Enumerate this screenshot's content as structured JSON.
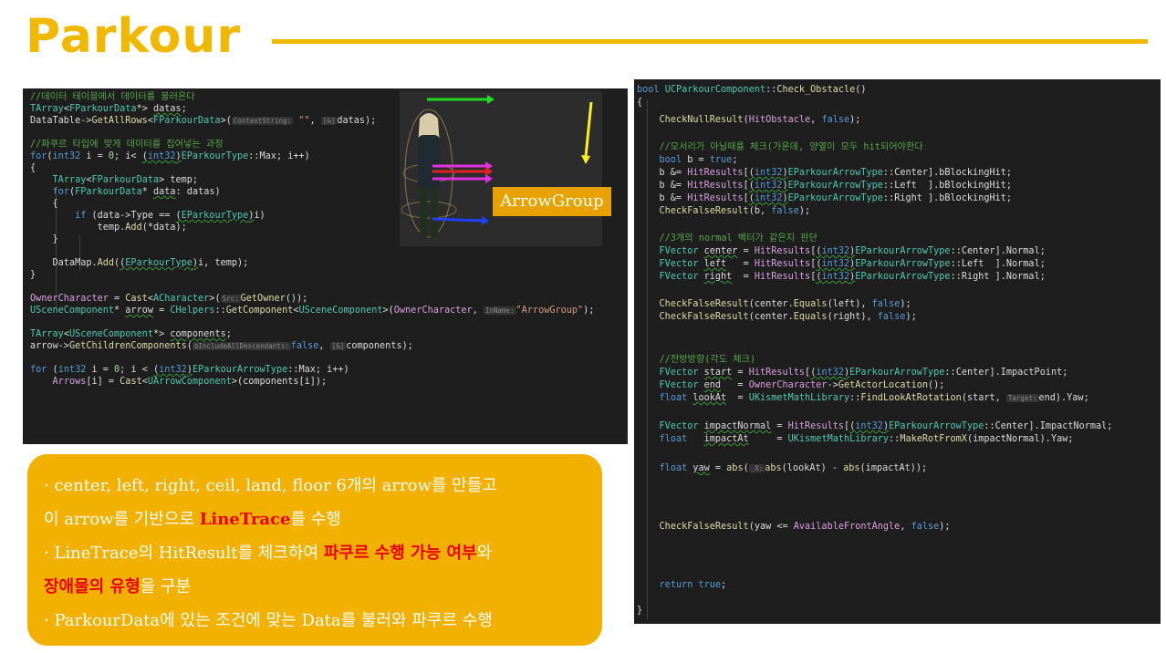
{
  "slide": {
    "title": "Parkour"
  },
  "left_code": {
    "lines": [
      "//데이터 테이블에서 데이터를 불러온다",
      "TArray<FParkourData*> datas;",
      "DataTable->GetAllRows<FParkourData>(\"\", datas);",
      "",
      "//파쿠르 타입에 맞게 데이터를 집어넣는 과정",
      "for(int32 i = 0; i< (int32)EParkourType::Max; i++)",
      "{",
      "    TArray<FParkourData> temp;",
      "    for(FParkourData* data: datas)",
      "    {",
      "        if (data->Type == (EParkourType)i)",
      "            temp.Add(*data);",
      "    }",
      "",
      "    DataMap.Add((EParkourType)i, temp);",
      "}",
      "",
      "OwnerCharacter = Cast<ACharacter>(GetOwner());",
      "USceneComponent* arrow = CHelpers::GetComponent<USceneComponent>(OwnerCharacter, \"ArrowGroup\");",
      "",
      "TArray<USceneComponent*> components;",
      "arrow->GetChildrenComponents(false, components);",
      "",
      "for (int32 i = 0; i < (int32)EParkourArrowType::Max; i++)",
      "    Arrows[i] = Cast<UArrowComponent>(components[i]);"
    ],
    "hints": {
      "context_string": "ContextString:",
      "ref": "[&]",
      "src": "Src:",
      "in_name": "InName:",
      "include_all": "bIncludeAllDescendants:"
    }
  },
  "figure": {
    "arrow_group_label": "ArrowGroup"
  },
  "right_code": {
    "lines": [
      "bool UCParkourComponent::Check_Obstacle()",
      "{",
      "    CheckNullResult(HitObstacle, false);",
      "",
      "    //모서리가 아닐때를 체크(가운데, 양옆이 모두 hit되어야한다",
      "    bool b = true;",
      "    b &= HitResults[(int32)EParkourArrowType::Center].bBlockingHit;",
      "    b &= HitResults[(int32)EParkourArrowType::Left  ].bBlockingHit;",
      "    b &= HitResults[(int32)EParkourArrowType::Right ].bBlockingHit;",
      "    CheckFalseResult(b, false);",
      "",
      "    //3개의 normal 벡터가 같은지 판단",
      "    FVector center = HitResults[(int32)EParkourArrowType::Center].Normal;",
      "    FVector left   = HitResults[(int32)EParkourArrowType::Left  ].Normal;",
      "    FVector right  = HitResults[(int32)EParkourArrowType::Right ].Normal;",
      "",
      "    CheckFalseResult(center.Equals(left), false);",
      "    CheckFalseResult(center.Equals(right), false);",
      "",
      "",
      "    //전방방향(각도 체크)",
      "    FVector start = HitResults[(int32)EParkourArrowType::Center].ImpactPoint;",
      "    FVector end   = OwnerCharacter->GetActorLocation();",
      "    float lookAt  = UKismetMathLibrary::FindLookAtRotation(start, end).Yaw;",
      "",
      "    FVector impactNormal = HitResults[(int32)EParkourArrowType::Center].ImpactNormal;",
      "    float   impactAt     = UKismetMathLibrary::MakeRotFromX(impactNormal).Yaw;",
      "",
      "    float yaw = abs(abs(lookAt) - abs(impactAt));",
      "",
      "",
      "",
      "    CheckFalseResult(yaw <= AvailableFrontAngle, false);",
      "",
      "",
      "    return true;",
      "}"
    ],
    "hints": {
      "target": "Target:",
      "x": "_X:"
    }
  },
  "panel": {
    "line1": "· center, left, right, ceil, land, floor  6개의 arrow를 만들고",
    "line2_pre": " 이 arrow를 기반으로 ",
    "line2_red": "LineTrace",
    "line2_post": "를 수행",
    "line3_pre": "· LineTrace의 HitResult를 체크하여 ",
    "line3_red": "파쿠르 수행 가능 여부",
    "line3_post": "와",
    "line4_red": "장애물의 유형",
    "line4_post": "을 구분",
    "line5": "· ParkourData에 있는 조건에 맞는 Data를 불러와 파쿠르 수행"
  },
  "colors": {
    "accent": "#f0b800",
    "panel": "#f2b000",
    "highlight_red": "#e8000b",
    "code_bg": "#1e1e1e"
  }
}
